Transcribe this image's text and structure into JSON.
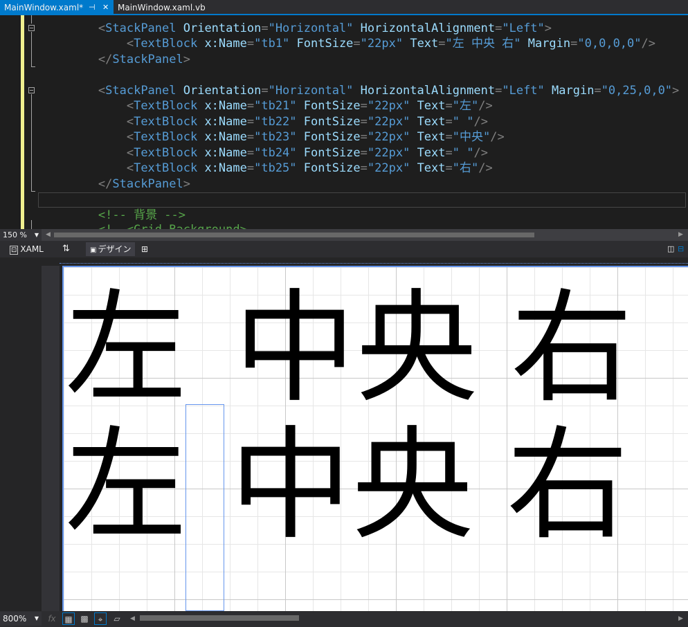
{
  "tabs": [
    {
      "label": "MainWindow.xaml*",
      "pin_icon": "⊣",
      "close_icon": "✕"
    },
    {
      "label": "MainWindow.xaml.vb"
    }
  ],
  "code": {
    "l1": {
      "indent": "        ",
      "lt": "<",
      "el": "StackPanel",
      "a1": " Orientation",
      "eq1": "=",
      "v1": "\"Horizontal\"",
      "a2": " HorizontalAlignment",
      "eq2": "=",
      "v2": "\"Left\"",
      "gt": ">"
    },
    "l2": {
      "indent": "            ",
      "lt": "<",
      "el": "TextBlock",
      "a1": " x:Name",
      "eq1": "=",
      "v1": "\"tb1\"",
      "a2": " FontSize",
      "eq2": "=",
      "v2": "\"22px\"",
      "a3": " Text",
      "eq3": "=",
      "v3": "\"左 中央 右\"",
      "a4": " Margin",
      "eq4": "=",
      "v4": "\"0,0,0,0\"",
      "gt": "/>"
    },
    "l3": {
      "indent": "        ",
      "lt": "</",
      "el": "StackPanel",
      "gt": ">"
    },
    "l5": {
      "indent": "        ",
      "lt": "<",
      "el": "StackPanel",
      "a1": " Orientation",
      "eq1": "=",
      "v1": "\"Horizontal\"",
      "a2": " HorizontalAlignment",
      "eq2": "=",
      "v2": "\"Left\"",
      "a3": " Margin",
      "eq3": "=",
      "v3": "\"0,25,0,0\"",
      "gt": ">"
    },
    "l6": {
      "indent": "            ",
      "lt": "<",
      "el": "TextBlock",
      "a1": " x:Name",
      "eq1": "=",
      "v1": "\"tb21\"",
      "a2": " FontSize",
      "eq2": "=",
      "v2": "\"22px\"",
      "a3": " Text",
      "eq3": "=",
      "v3": "\"左\"",
      "gt": "/>"
    },
    "l7": {
      "indent": "            ",
      "lt": "<",
      "el": "TextBlock",
      "a1": " x:Name",
      "eq1": "=",
      "v1": "\"tb22\"",
      "a2": " FontSize",
      "eq2": "=",
      "v2": "\"22px\"",
      "a3": " Text",
      "eq3": "=",
      "v3": "\" \"",
      "gt": "/>"
    },
    "l8": {
      "indent": "            ",
      "lt": "<",
      "el": "TextBlock",
      "a1": " x:Name",
      "eq1": "=",
      "v1": "\"tb23\"",
      "a2": " FontSize",
      "eq2": "=",
      "v2": "\"22px\"",
      "a3": " Text",
      "eq3": "=",
      "v3": "\"中央\"",
      "gt": "/>"
    },
    "l9": {
      "indent": "            ",
      "lt": "<",
      "el": "TextBlock",
      "a1": " x:Name",
      "eq1": "=",
      "v1": "\"tb24\"",
      "a2": " FontSize",
      "eq2": "=",
      "v2": "\"22px\"",
      "a3": " Text",
      "eq3": "=",
      "v3": "\" \"",
      "gt": "/>"
    },
    "l10": {
      "indent": "            ",
      "lt": "<",
      "el": "TextBlock",
      "a1": " x:Name",
      "eq1": "=",
      "v1": "\"tb25\"",
      "a2": " FontSize",
      "eq2": "=",
      "v2": "\"22px\"",
      "a3": " Text",
      "eq3": "=",
      "v3": "\"右\"",
      "gt": "/>"
    },
    "l11": {
      "indent": "        ",
      "lt": "</",
      "el": "StackPanel",
      "gt": ">"
    },
    "l13": {
      "indent": "        ",
      "comment": "<!-- 背景 -->"
    },
    "l14": {
      "indent": "        ",
      "comment": "<!--<Grid Background>"
    }
  },
  "editor_zoom": "150 %",
  "view_tabs": {
    "xaml": "XAML",
    "swap": "⇅",
    "design": "デザイン"
  },
  "design_text": {
    "row1": {
      "left": "左",
      "center": "中央",
      "right": "右"
    },
    "row2": {
      "left": "左",
      "center": "中央",
      "right": "右"
    }
  },
  "design_zoom": "800%",
  "bottom_buttons": {
    "fx": "fx"
  },
  "colors": {
    "accent": "#007acc",
    "selection": "#6495ed",
    "change_marker": "#efef8f"
  }
}
